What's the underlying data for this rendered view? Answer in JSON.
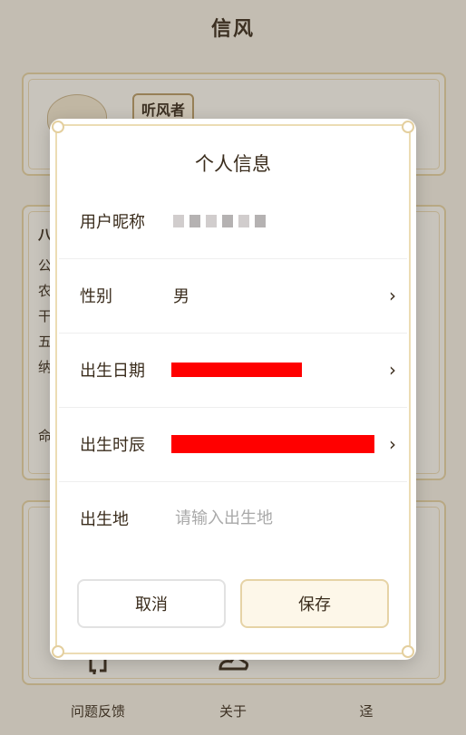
{
  "app": {
    "title": "信风"
  },
  "background": {
    "profile": {
      "nickname_badge": "听风者"
    },
    "info_card": {
      "labels": [
        "八",
        "公",
        "农",
        "干",
        "五",
        "纳",
        "命"
      ]
    },
    "bottom_nav": [
      {
        "label": "问题反馈",
        "icon": "feedback-icon"
      },
      {
        "label": "关于",
        "icon": "cloud-icon"
      },
      {
        "label": "迳",
        "icon": "extra-icon"
      }
    ]
  },
  "dialog": {
    "title": "个人信息",
    "fields": {
      "nickname": {
        "label": "用户昵称"
      },
      "gender": {
        "label": "性别",
        "value": "男"
      },
      "birth_date": {
        "label": "出生日期"
      },
      "birth_hour": {
        "label": "出生时辰"
      },
      "birthplace": {
        "label": "出生地",
        "placeholder": "请输入出生地"
      }
    },
    "buttons": {
      "cancel": "取消",
      "save": "保存"
    }
  },
  "colors": {
    "accent_gold": "#e6d3a6",
    "redaction": "#ff0000",
    "text": "#3a2c1c"
  }
}
